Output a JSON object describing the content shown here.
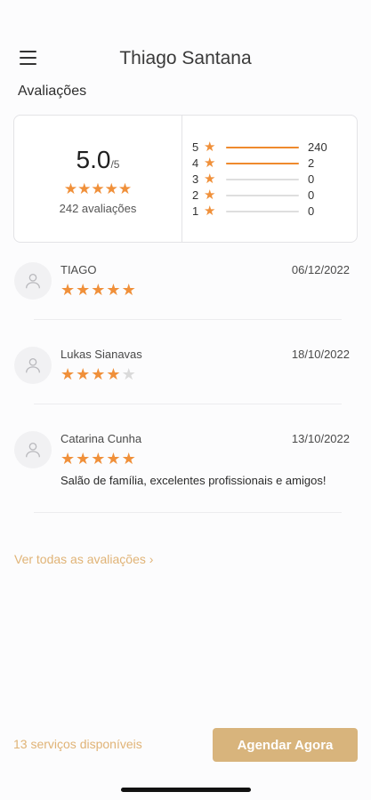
{
  "header": {
    "title": "Thiago Santana"
  },
  "section_title": "Avaliações",
  "summary": {
    "score": "5.0",
    "score_max": "/5",
    "stars_filled": 5,
    "count_label": "242 avaliações",
    "distribution": [
      {
        "label": "5",
        "count": "240",
        "fraction": 1.0
      },
      {
        "label": "4",
        "count": "2",
        "fraction": 1.0
      },
      {
        "label": "3",
        "count": "0",
        "fraction": 0
      },
      {
        "label": "2",
        "count": "0",
        "fraction": 0
      },
      {
        "label": "1",
        "count": "0",
        "fraction": 0
      }
    ]
  },
  "reviews": [
    {
      "name": "TIAGO",
      "date": "06/12/2022",
      "rating": 5,
      "comment": ""
    },
    {
      "name": "Lukas Sianavas",
      "date": "18/10/2022",
      "rating": 4,
      "comment": ""
    },
    {
      "name": "Catarina Cunha",
      "date": "13/10/2022",
      "rating": 5,
      "comment": "Salão de família, excelentes profissionais e amigos!"
    }
  ],
  "see_all_label": "Ver todas as avaliações ›",
  "footer": {
    "services_label": "13 serviços disponíveis",
    "cta_label": "Agendar Agora"
  },
  "colors": {
    "star": "#f0903a",
    "star_empty": "#dadada",
    "accent": "#d8b47c",
    "link": "#e0b376"
  },
  "icons": {
    "menu": "hamburger-icon",
    "avatar": "user-icon",
    "star": "star-icon",
    "chevron": "chevron-right-icon"
  }
}
